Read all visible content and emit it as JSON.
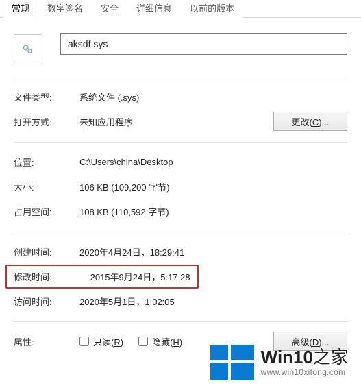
{
  "tabs": {
    "general": "常规",
    "digital_signatures": "数字签名",
    "security": "安全",
    "details": "详细信息",
    "previous_versions": "以前的版本"
  },
  "filename": "aksdf.sys",
  "labels": {
    "file_type": "文件类型:",
    "opens_with": "打开方式:",
    "location": "位置:",
    "size": "大小:",
    "size_on_disk": "占用空间:",
    "created": "创建时间:",
    "modified": "修改时间:",
    "accessed": "访问时间:",
    "attributes": "属性:"
  },
  "values": {
    "file_type": "系统文件 (.sys)",
    "opens_with": "未知应用程序",
    "location": "C:\\Users\\china\\Desktop",
    "size": "106 KB (109,200 字节)",
    "size_on_disk": "108 KB (110,592 字节)",
    "created": "2020年4月24日，18:29:41",
    "modified": "2015年9月24日，5:17:28",
    "accessed": "2020年5月1日，1:02:05"
  },
  "buttons": {
    "change": "更改(C)...",
    "change_u": "C",
    "advanced": "高级(D)...",
    "advanced_u": "D"
  },
  "checkboxes": {
    "readonly": "只读(R)",
    "readonly_u": "R",
    "hidden": "隐藏(H)",
    "hidden_u": "H"
  },
  "watermark": {
    "title_prefix": "Win10",
    "title_suffix": "之家",
    "url": "www.win10xitong.com"
  }
}
